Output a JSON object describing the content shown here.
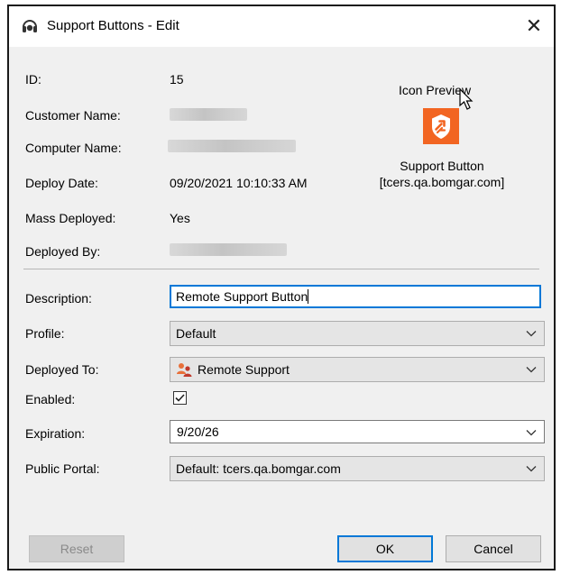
{
  "window": {
    "title": "Support Buttons - Edit",
    "close_label": "✕"
  },
  "info": {
    "id_label": "ID:",
    "id_value": "15",
    "customer_name_label": "Customer Name:",
    "computer_name_label": "Computer Name:",
    "deploy_date_label": "Deploy Date:",
    "deploy_date_value": "09/20/2021 10:10:33 AM",
    "mass_deployed_label": "Mass Deployed:",
    "mass_deployed_value": "Yes",
    "deployed_by_label": "Deployed By:"
  },
  "preview": {
    "title": "Icon Preview",
    "caption_line1": "Support Button",
    "caption_line2": "[tcers.qa.bomgar.com]",
    "icon_color": "#f26522"
  },
  "form": {
    "description_label": "Description:",
    "description_value": "Remote Support Button",
    "profile_label": "Profile:",
    "profile_value": "Default",
    "deployed_to_label": "Deployed To:",
    "deployed_to_value": "Remote Support",
    "enabled_label": "Enabled:",
    "enabled_checked": true,
    "expiration_label": "Expiration:",
    "expiration_value": "9/20/26",
    "public_portal_label": "Public Portal:",
    "public_portal_value": "Default: tcers.qa.bomgar.com"
  },
  "buttons": {
    "reset": "Reset",
    "ok": "OK",
    "cancel": "Cancel"
  },
  "colors": {
    "focus_accent": "#0078d7",
    "dialog_bg": "#f0f0f0"
  }
}
